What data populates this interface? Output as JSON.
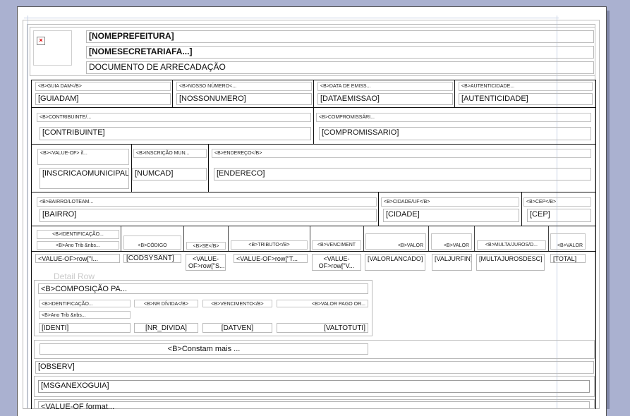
{
  "header": {
    "image_alt": "×",
    "prefeitura": "[NOMEPREFEITURA]",
    "secretaria": "[NOMESECRETARIAFA...]",
    "doc_title": "DOCUMENTO DE ARRECADAÇÃO"
  },
  "row1": {
    "labels": [
      "<B>GUIA DAM</B>",
      "<B>NOSSO NÚMERO<...",
      "<B>DATA DE EMISS...",
      "<B>AUTENTICIDADE..."
    ],
    "values": [
      "[GUIADAM]",
      "[NOSSONUMERO]",
      "[DATAEMISSAO]",
      "[AUTENTICIDADE]"
    ]
  },
  "row2": {
    "labels": [
      "<B>CONTRIBUINTE/...",
      "<B>COMPROMISSÁRI..."
    ],
    "values": [
      "[CONTRIBUINTE]",
      "[COMPROMISSARIO]"
    ]
  },
  "row3": {
    "labels": [
      "<B><VALUE-OF> if...",
      "<B>INSCRIÇÃO MUN...",
      "<B>ENDEREÇO</B>"
    ],
    "values": [
      "[INSCRICAOMUNICIPAL]",
      "[NUMCAD]",
      "[ENDERECO]"
    ]
  },
  "row4": {
    "labels": [
      "<B>BAIRRO/LOTEAM...",
      "<B>CIDADE/UF</B>",
      "<B>CEP</B>"
    ],
    "values": [
      "[BAIRRO]",
      "[CIDADE]",
      "[CEP]"
    ]
  },
  "table": {
    "headers": [
      "<B>IDENTIFICAÇÃO...",
      "<B>Ano Trib &nbs...",
      "<B>CÓDIGO",
      "<B>SE</B>",
      "<B>TRIBUTO</B>",
      "<B>VENCIMENT",
      "<B>VALOR",
      "<B>VALOR",
      "<B>MULTA/JUROS/D...",
      "<B>VALOR"
    ],
    "values": [
      "<VALUE-OF>row[\"I...",
      "[CODSYSANT]",
      "<VALUE-OF>row[\"S...",
      "<VALUE-OF>row[\"T...",
      "<VALUE-OF>row[\"V...",
      "[VALORLANCADO]",
      "[VALJURFIN]",
      "[MULTAJUROSDESC]",
      "[TOTAL]"
    ],
    "detail_row": "Detail Row"
  },
  "composicao": {
    "title": "<B>COMPOSIÇÃO PA...",
    "labels": [
      "<B>IDENTIFICAÇÃO...",
      "<B>Ano Trib &nbs...",
      "<B>NR DÍVIDA</B>",
      "<B>VENCIMENTO</B>",
      "<B>VALOR PAGO OR..."
    ],
    "values": [
      "[IDENTI]",
      "[NR_DIVIDA]",
      "[DATVEN]",
      "[VALTOTUTI]"
    ]
  },
  "constam": "<B>Constam mais ...",
  "observ": "[OBSERV]",
  "msganexo": "[MSGANEXOGUIA]",
  "footer_value": "<VALUE-OF format..."
}
